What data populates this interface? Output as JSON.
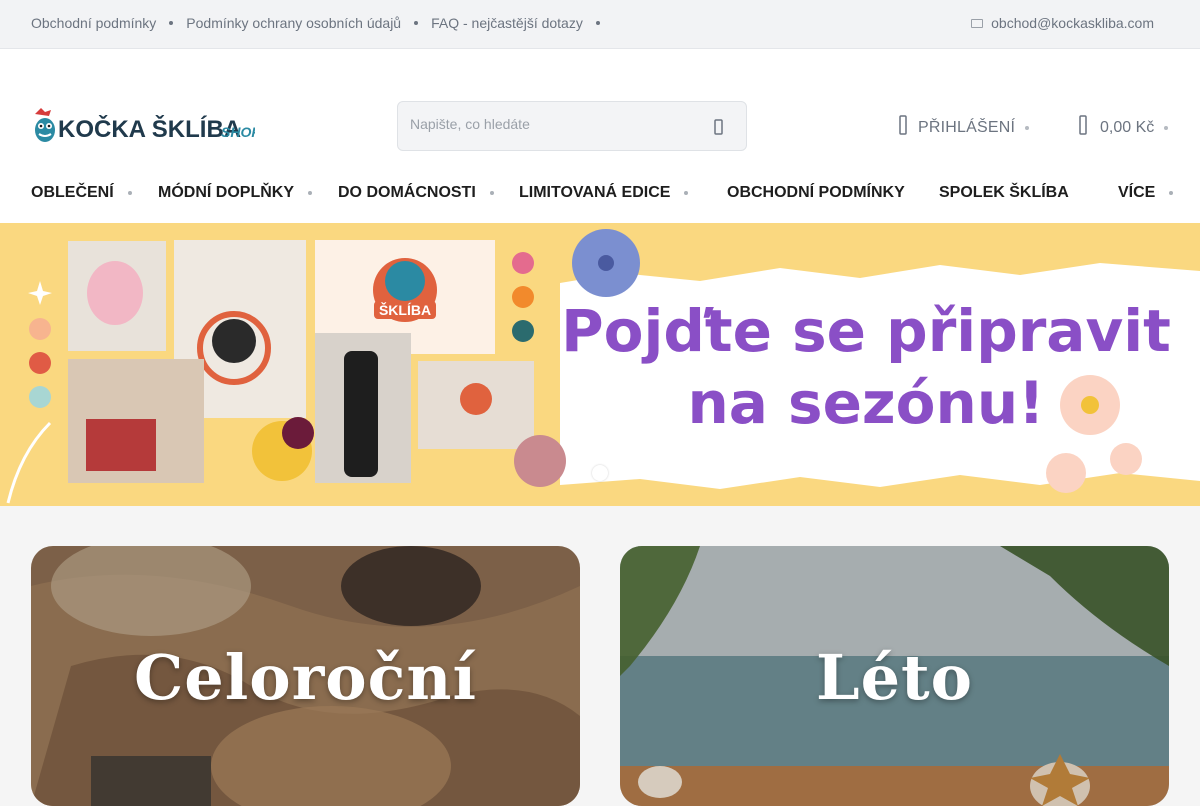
{
  "topbar": {
    "links": [
      "Obchodní podmínky",
      "Podmínky ochrany osobních údajů",
      "FAQ - nejčastější dotazy"
    ],
    "email": "obchod@kockaskliba.com"
  },
  "header": {
    "logo_text": "KOČKA ŠKLÍBA",
    "logo_suffix": "SHOP",
    "search_placeholder": "Napište, co hledáte",
    "login_label": "PŘIHLÁŠENÍ",
    "cart_label": "0,00 Kč"
  },
  "nav": {
    "items": [
      "OBLEČENÍ",
      "MÓDNÍ DOPLŇKY",
      "DO DOMÁCNOSTI",
      "LIMITOVANÁ EDICE",
      "OBCHODNÍ PODMÍNKY",
      "SPOLEK ŠKLÍBA",
      "VÍCE"
    ]
  },
  "banner": {
    "headline_line1": "Pojďte se připravit",
    "headline_line2": "na sezónu!",
    "badge_text": "ŠKLÍBA",
    "background": "#fad880",
    "headline_color": "#8a4fc6"
  },
  "categories": [
    {
      "title": "Celoroční"
    },
    {
      "title": "Léto"
    }
  ]
}
